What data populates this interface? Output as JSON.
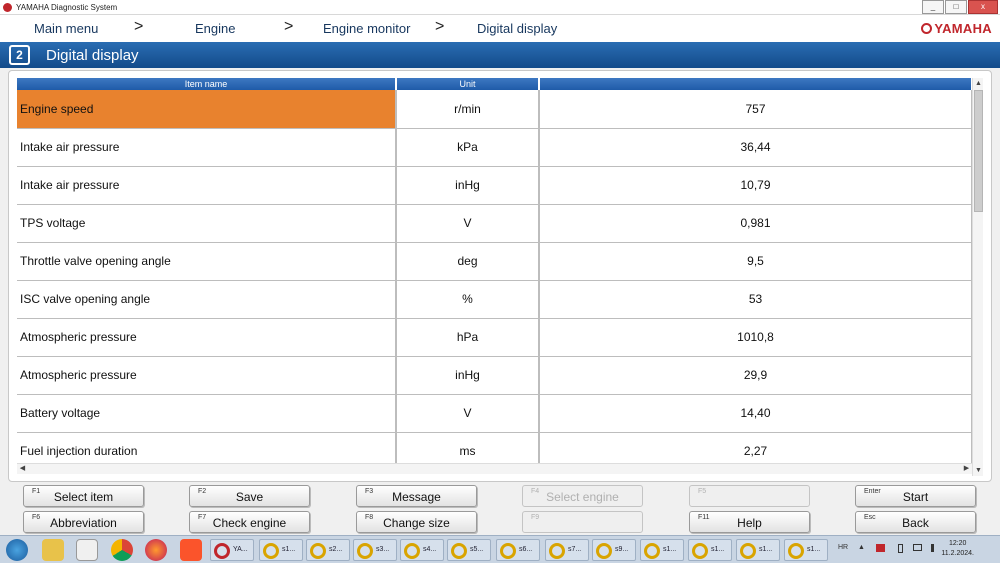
{
  "window": {
    "title": "YAMAHA Diagnostic System",
    "controls": [
      "_",
      "□",
      "x"
    ]
  },
  "breadcrumb": {
    "items": [
      "Main menu",
      "Engine",
      "Engine monitor",
      "Digital display"
    ],
    "separator": ">",
    "logo": "YAMAHA"
  },
  "header": {
    "title": "Digital display",
    "icon": "digital-display-icon"
  },
  "table": {
    "columns": [
      "Item name",
      "Unit",
      ""
    ],
    "rows": [
      {
        "name": "Engine speed",
        "unit": "r/min",
        "value": "757"
      },
      {
        "name": "Intake air pressure",
        "unit": "kPa",
        "value": "36,44"
      },
      {
        "name": "Intake air pressure",
        "unit": "inHg",
        "value": "10,79"
      },
      {
        "name": "TPS voltage",
        "unit": "V",
        "value": "0,981"
      },
      {
        "name": "Throttle valve opening angle",
        "unit": "deg",
        "value": "9,5"
      },
      {
        "name": "ISC valve opening angle",
        "unit": "%",
        "value": "53"
      },
      {
        "name": "Atmospheric pressure",
        "unit": "hPa",
        "value": "1010,8"
      },
      {
        "name": "Atmospheric pressure",
        "unit": "inHg",
        "value": "29,9"
      },
      {
        "name": "Battery voltage",
        "unit": "V",
        "value": "14,40"
      },
      {
        "name": "Fuel injection duration",
        "unit": "ms",
        "value": "2,27"
      }
    ],
    "selected_row_color": "#e8822e"
  },
  "fkeys": {
    "f1": {
      "key": "F1",
      "label": "Select item"
    },
    "f2": {
      "key": "F2",
      "label": "Save"
    },
    "f3": {
      "key": "F3",
      "label": "Message"
    },
    "f4": {
      "key": "F4",
      "label": "Select engine"
    },
    "f5": {
      "key": "F5",
      "label": ""
    },
    "enter": {
      "key": "Enter",
      "label": "Start"
    },
    "f6": {
      "key": "F6",
      "label": "Abbreviation"
    },
    "f7": {
      "key": "F7",
      "label": "Check engine"
    },
    "f8": {
      "key": "F8",
      "label": "Change size"
    },
    "f9": {
      "key": "F9",
      "label": ""
    },
    "f11": {
      "key": "F11",
      "label": "Help"
    },
    "esc": {
      "key": "Esc",
      "label": "Back"
    }
  },
  "taskbar": {
    "apps": [
      "YA..."
    ],
    "windows": [
      "s1...",
      "s2...",
      "s3...",
      "s4...",
      "s5...",
      "s6...",
      "s7...",
      "s9...",
      "s1...",
      "s1...",
      "s1...",
      "s1..."
    ],
    "lang": "HR",
    "time": "12:20",
    "date": "11.2.2024."
  }
}
